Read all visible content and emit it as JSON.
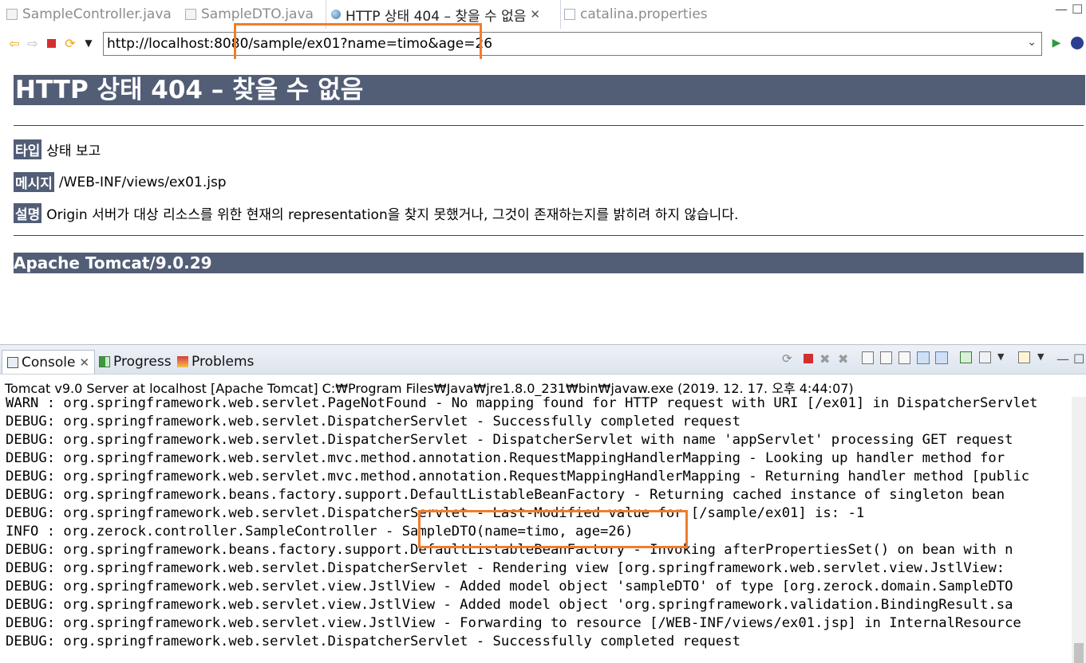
{
  "editor_tabs": [
    {
      "label": "SampleController.java",
      "active": false
    },
    {
      "label": "SampleDTO.java",
      "active": false
    },
    {
      "label": "HTTP 상태 404 – 찾을 수 없음",
      "active": true
    },
    {
      "label": "catalina.properties",
      "active": false
    }
  ],
  "browser": {
    "url": "http://localhost:8080/sample/ex01?name=timo&age=26"
  },
  "error_page": {
    "title": "HTTP 상태 404 – 찾을 수 없음",
    "rows": [
      {
        "label": "타입",
        "value": "상태 보고"
      },
      {
        "label": "메시지",
        "value": "/WEB-INF/views/ex01.jsp"
      },
      {
        "label": "설명",
        "value": "Origin 서버가 대상 리소스를 위한 현재의 representation을 찾지 못했거나, 그것이 존재하는지를 밝히려 하지 않습니다."
      }
    ],
    "footer": "Apache Tomcat/9.0.29"
  },
  "console": {
    "tabs": [
      {
        "label": "Console",
        "active": true
      },
      {
        "label": "Progress",
        "active": false
      },
      {
        "label": "Problems",
        "active": false
      }
    ],
    "description": "Tomcat v9.0 Server at localhost [Apache Tomcat] C:₩Program Files₩Java₩jre1.8.0_231₩bin₩javaw.exe (2019. 12. 17. 오후 4:44:07)",
    "lines": [
      "WARN : org.springframework.web.servlet.PageNotFound - No mapping found for HTTP request with URI [/ex01] in DispatcherServlet",
      "DEBUG: org.springframework.web.servlet.DispatcherServlet - Successfully completed request",
      "DEBUG: org.springframework.web.servlet.DispatcherServlet - DispatcherServlet with name 'appServlet' processing GET request",
      "DEBUG: org.springframework.web.servlet.mvc.method.annotation.RequestMappingHandlerMapping - Looking up handler method for",
      "DEBUG: org.springframework.web.servlet.mvc.method.annotation.RequestMappingHandlerMapping - Returning handler method [public",
      "DEBUG: org.springframework.beans.factory.support.DefaultListableBeanFactory - Returning cached instance of singleton bean",
      "DEBUG: org.springframework.web.servlet.DispatcherServlet - Last-Modified value for [/sample/ex01] is: -1",
      "INFO : org.zerock.controller.SampleController - SampleDTO(name=timo, age=26)",
      "DEBUG: org.springframework.beans.factory.support.DefaultListableBeanFactory - Invoking afterPropertiesSet() on bean with n",
      "DEBUG: org.springframework.web.servlet.DispatcherServlet - Rendering view [org.springframework.web.servlet.view.JstlView:",
      "DEBUG: org.springframework.web.servlet.view.JstlView - Added model object 'sampleDTO' of type [org.zerock.domain.SampleDTO",
      "DEBUG: org.springframework.web.servlet.view.JstlView - Added model object 'org.springframework.validation.BindingResult.sa",
      "DEBUG: org.springframework.web.servlet.view.JstlView - Forwarding to resource [/WEB-INF/views/ex01.jsp] in InternalResource",
      "DEBUG: org.springframework.web.servlet.DispatcherServlet - Successfully completed request"
    ]
  },
  "colors": {
    "tomcat_bar": "#525d76",
    "highlight": "#f07d2b"
  }
}
